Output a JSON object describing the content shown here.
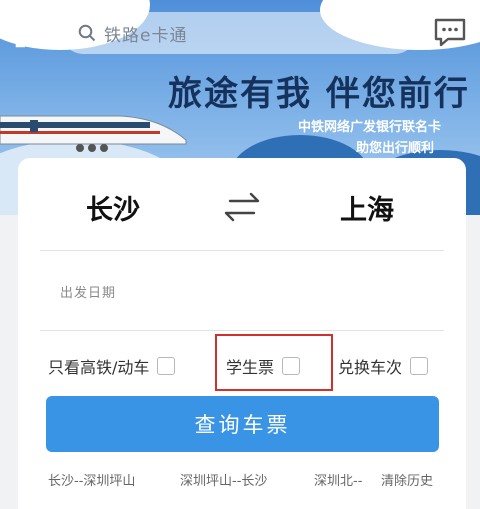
{
  "search": {
    "placeholder": "铁路e卡通"
  },
  "banner": {
    "slogan": "旅途有我 伴您前行",
    "line1": "中铁网络广发银行联名卡",
    "line2": "助您出行顺利"
  },
  "route": {
    "from": "长沙",
    "to": "上海"
  },
  "date": {
    "label": "出发日期"
  },
  "options": {
    "high_speed_label": "只看高铁/动车",
    "student_label": "学生票",
    "exchange_label": "兑换车次",
    "high_speed_checked": false,
    "student_checked": false,
    "exchange_checked": false
  },
  "query_button": "查询车票",
  "history": [
    "长沙--深圳坪山",
    "深圳坪山--长沙",
    "深圳北--"
  ],
  "clear_history": "清除历史",
  "colors": {
    "primary": "#3a94e6",
    "highlight": "#d0312d",
    "slogan": "#16325c"
  },
  "icons": {
    "scan": "scan-icon",
    "search": "search-icon",
    "message": "message-icon",
    "swap": "swap-icon"
  }
}
